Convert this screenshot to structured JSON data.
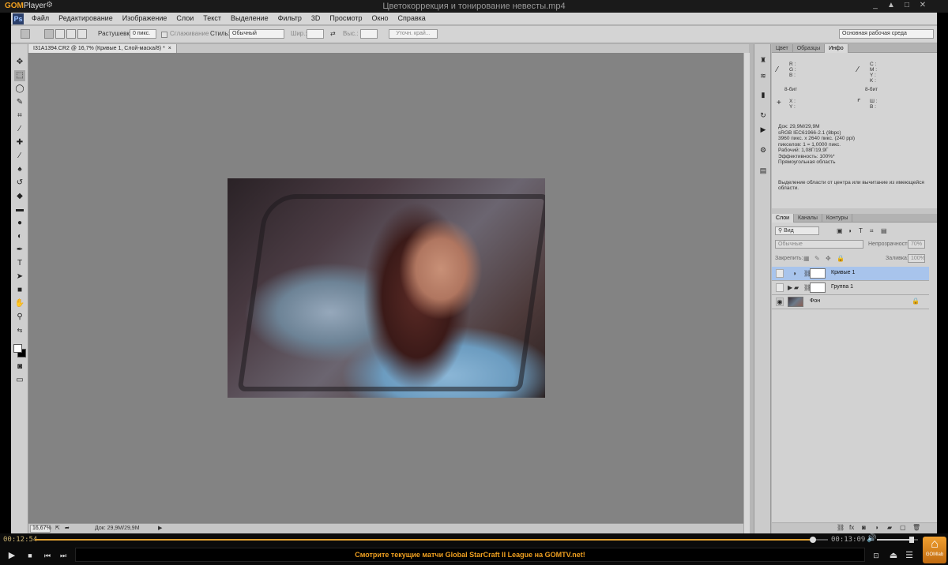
{
  "gom": {
    "logo": "GOM",
    "logo_suffix": "Player",
    "settings_icon": "gear-icon",
    "title": "Цветокоррекция и тонирование невесты.mp4",
    "window_buttons": [
      "_",
      "▲",
      "□",
      "✕"
    ],
    "current_time": "00:12:54",
    "total_time": "00:13:09",
    "progress": 0.981,
    "volume": 0.85,
    "marquee": "Смотрите текущие матчи Global StarCraft II League на GOMTV.net!",
    "gomlab_label": "GOMlab"
  },
  "photoshop": {
    "logo": "Ps",
    "menu": [
      "Файл",
      "Редактирование",
      "Изображение",
      "Слои",
      "Текст",
      "Выделение",
      "Фильтр",
      "3D",
      "Просмотр",
      "Окно",
      "Справка"
    ],
    "options": {
      "feather_label": "Растушевка:",
      "feather_value": "0 пикс.",
      "antialias_label": "Сглаживание",
      "style_label": "Стиль:",
      "style_value": "Обычный",
      "width_label": "Шир.:",
      "height_label": "Выс.:",
      "refine_edge": "Уточн. край...",
      "workspace": "Основная рабочая среда"
    },
    "document_tab": "I31A1394.CR2 @ 16,7% (Кривые 1, Слой-маска/8) *",
    "document_tab_close": "×",
    "status": {
      "zoom": "16,67%",
      "doc": "Док: 29,9M/29,9M"
    },
    "info_panel": {
      "tabs": [
        "Цвет",
        "Образцы",
        "Инфо"
      ],
      "active_tab": "Инфо",
      "rgb_labels": "R :\nG :\nB :",
      "cmyk_labels": "C :\nM :\nY :\nK :",
      "bit_left": "8-бит",
      "bit_right": "8-бит",
      "xy_labels": "X :\nY :",
      "wh_labels": "Ш :\nВ :",
      "doc_info": "Док: 29,9M/29,9M\nsRGB IEC61966-2.1 (8bpc)\n3960 пикс. x 2640 пикс. (240 ppi)\nпикселов: 1 = 1,0000 пикс.\nРабочий: 1,08Г/19,9Г\nЭффективность: 100%*\nПрямоугольная область",
      "hint": "Выделение области от центра или вычитание из имеющейся\nобласти."
    },
    "layers_panel": {
      "tabs": [
        "Слои",
        "Каналы",
        "Контуры"
      ],
      "active_tab": "Слои",
      "filter_kind": "Вид",
      "blend_mode": "Обычные",
      "opacity_label": "Непрозрачность:",
      "opacity_value": "70%",
      "lock_label": "Закрепить:",
      "fill_label": "Заливка:",
      "fill_value": "100%",
      "layers": [
        {
          "name": "Кривые 1",
          "selected": true
        },
        {
          "name": "Группа 1",
          "selected": false
        },
        {
          "name": "Фон",
          "selected": false
        }
      ]
    }
  }
}
